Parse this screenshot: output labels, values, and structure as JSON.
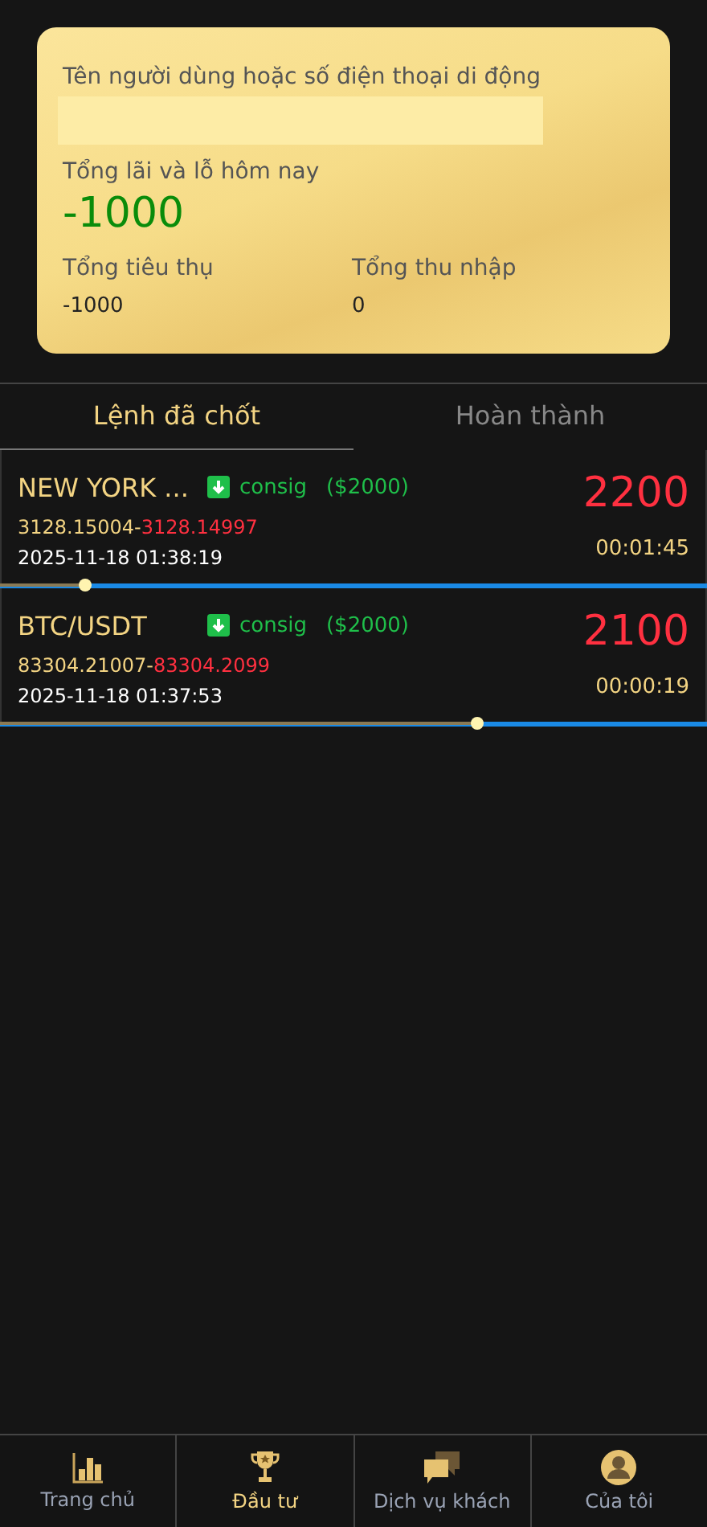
{
  "summary": {
    "user_label": "Tên người dùng hoặc số điện thoại di động",
    "pnl_label": "Tổng lãi và lỗ hôm nay",
    "pnl_value": "-1000",
    "spent_label": "Tổng tiêu thụ",
    "spent_value": "-1000",
    "income_label": "Tổng thu nhập",
    "income_value": "0"
  },
  "tabs": [
    {
      "label": "Lệnh đã chốt",
      "selected": true
    },
    {
      "label": "Hoàn thành",
      "selected": false
    }
  ],
  "orders": [
    {
      "symbol": "NEW YORK ...",
      "type": "consig",
      "amount": "($2000)",
      "open_price": "3128.15004-",
      "close_price": "3128.14997",
      "time": "2025-11-18 01:38:19",
      "result": "2200",
      "countdown": "00:01:45",
      "level": 0.12
    },
    {
      "symbol": "BTC/USDT",
      "type": "consig",
      "amount": "($2000)",
      "open_price": "83304.21007-",
      "close_price": "83304.2099",
      "time": "2025-11-18 01:37:53",
      "result": "2100",
      "countdown": "00:00:19",
      "level": 0.675
    }
  ],
  "nav": [
    {
      "label": "Trang chủ",
      "selected": false
    },
    {
      "label": "Đầu tư",
      "selected": true
    },
    {
      "label": "Dịch vụ khách",
      "selected": false
    },
    {
      "label": "Của tôi",
      "selected": false
    }
  ]
}
